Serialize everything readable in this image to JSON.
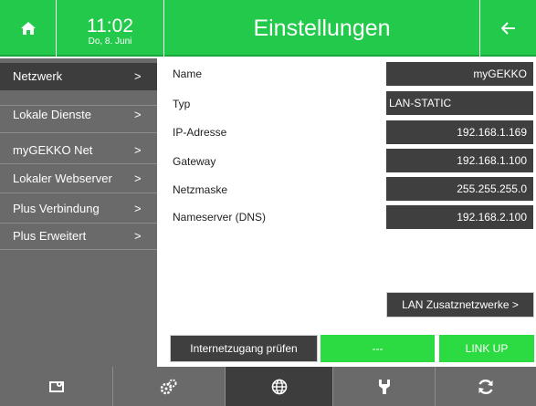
{
  "header": {
    "time": "11:02",
    "date": "Do, 8. Juni",
    "title": "Einstellungen",
    "home_icon": "home-icon",
    "back_icon": "arrow-left-icon",
    "accent": "#22c94b"
  },
  "sidebar": {
    "items": [
      {
        "label": "Netzwerk",
        "chevron": ">"
      },
      {
        "label": "Lokale Dienste",
        "chevron": ">"
      },
      {
        "label": "myGEKKO Net",
        "chevron": ">"
      },
      {
        "label": "Lokaler Webserver",
        "chevron": ">"
      },
      {
        "label": "Plus Verbindung",
        "chevron": ">"
      },
      {
        "label": "Plus Erweitert",
        "chevron": ">"
      }
    ]
  },
  "network": {
    "fields": [
      {
        "label": "Name",
        "value": "myGEKKO"
      },
      {
        "label": "Typ",
        "value": "LAN-STATIC"
      },
      {
        "label": "IP-Adresse",
        "value": "192.168.1.169"
      },
      {
        "label": "Gateway",
        "value": "192.168.1.100"
      },
      {
        "label": "Netzmaske",
        "value": "255.255.255.0"
      },
      {
        "label": "Nameserver (DNS)",
        "value": "192.168.2.100"
      }
    ],
    "lan_extra_label": "LAN Zusatznetzwerke >",
    "check_internet_label": "Internetzugang prüfen",
    "check_result": "---",
    "link_status": "LINK UP"
  },
  "bottombar": {
    "items": [
      "device-settings-icon",
      "system-gears-icon",
      "network-globe-icon",
      "service-wrench-icon",
      "refresh-icon"
    ]
  }
}
